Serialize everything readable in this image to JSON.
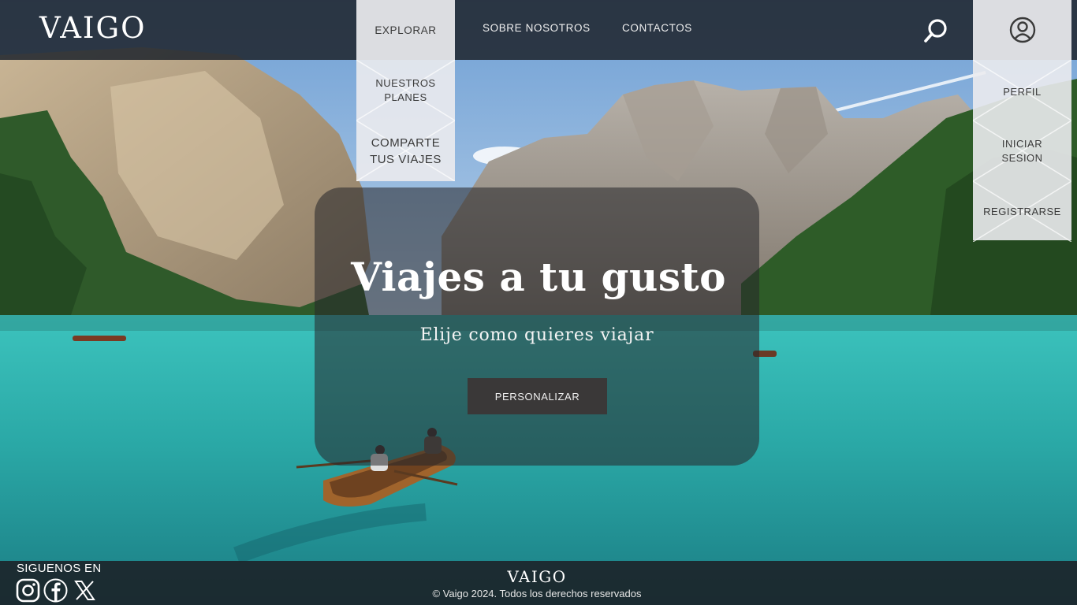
{
  "brand": {
    "logo": "VAIGO"
  },
  "nav": {
    "explore": "EXPLORAR",
    "about": "SOBRE NOSOTROS",
    "contacts": "CONTACTOS"
  },
  "explore_menu": {
    "items": [
      {
        "label": "NUESTROS PLANES"
      },
      {
        "label": "COMPARTE TUS VIAJES"
      }
    ]
  },
  "account_menu": {
    "items": [
      {
        "label": "PERFIL"
      },
      {
        "label": "INICIAR SESION"
      },
      {
        "label": "REGISTRARSE"
      }
    ]
  },
  "icons": {
    "search": "search-icon",
    "user": "user-circle-icon",
    "instagram": "instagram-icon",
    "facebook": "facebook-icon",
    "x": "x-icon"
  },
  "hero": {
    "title": "Viajes a tu gusto",
    "subtitle": "Elije como quieres viajar",
    "cta": "PERSONALIZAR"
  },
  "footer": {
    "follow": "SIGUENOS EN",
    "logo": "VAIGO",
    "copyright": "© Vaigo 2024. Todos los derechos reservados"
  },
  "colors": {
    "topbar": "#1e242c",
    "dropdown": "#ebebee",
    "hero_card": "#28282a",
    "cta": "#3a3838",
    "lake": "#2fb5b0"
  }
}
